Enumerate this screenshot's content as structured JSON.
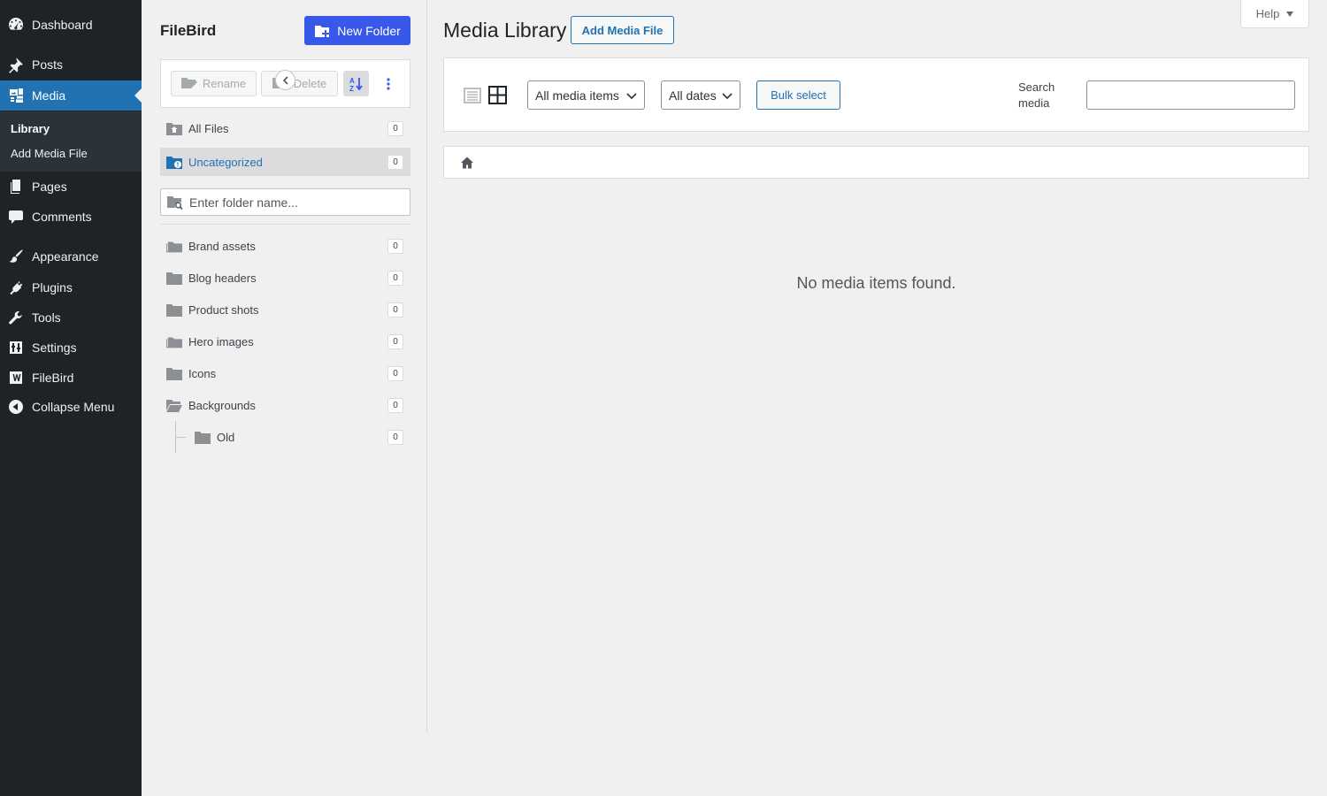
{
  "admin_menu": {
    "items": [
      {
        "key": "dashboard",
        "label": "Dashboard",
        "icon": "dashboard-icon"
      },
      {
        "key": "posts",
        "label": "Posts",
        "icon": "pushpin-icon"
      },
      {
        "key": "media",
        "label": "Media",
        "icon": "media-icon",
        "current": true
      },
      {
        "key": "pages",
        "label": "Pages",
        "icon": "pages-icon"
      },
      {
        "key": "comments",
        "label": "Comments",
        "icon": "comments-icon"
      },
      {
        "key": "appearance",
        "label": "Appearance",
        "icon": "paintbrush-icon"
      },
      {
        "key": "plugins",
        "label": "Plugins",
        "icon": "plugins-icon"
      },
      {
        "key": "tools",
        "label": "Tools",
        "icon": "wrench-icon"
      },
      {
        "key": "settings",
        "label": "Settings",
        "icon": "settings-icon"
      },
      {
        "key": "filebird",
        "label": "FileBird",
        "icon": "filebird-icon"
      },
      {
        "key": "collapse",
        "label": "Collapse Menu",
        "icon": "collapse-icon"
      }
    ],
    "submenu": {
      "library": "Library",
      "add_media_file": "Add Media File"
    }
  },
  "filebird": {
    "title": "FileBird",
    "new_folder_label": "New Folder",
    "rename_label": "Rename",
    "delete_label": "Delete",
    "all_files": {
      "label": "All Files",
      "count": "0"
    },
    "uncategorized": {
      "label": "Uncategorized",
      "count": "0"
    },
    "search_placeholder": "Enter folder name...",
    "folders": [
      {
        "label": "Brand assets",
        "count": "0",
        "icon": "folder-stack-icon"
      },
      {
        "label": "Blog headers",
        "count": "0",
        "icon": "folder-icon"
      },
      {
        "label": "Product shots",
        "count": "0",
        "icon": "folder-icon"
      },
      {
        "label": "Hero images",
        "count": "0",
        "icon": "folder-stack-icon"
      },
      {
        "label": "Icons",
        "count": "0",
        "icon": "folder-icon"
      },
      {
        "label": "Backgrounds",
        "count": "0",
        "icon": "folder-open-icon"
      },
      {
        "label": "Old",
        "count": "0",
        "icon": "folder-icon",
        "child_of": "Backgrounds"
      }
    ]
  },
  "main": {
    "title": "Media Library",
    "add_media_label": "Add Media File",
    "help_label": "Help",
    "media_type_filter": "All media items",
    "date_filter": "All dates",
    "bulk_select_label": "Bulk select",
    "search_label": "Search media",
    "search_value": "",
    "empty_message": "No media items found."
  },
  "colors": {
    "accent": "#3858e9",
    "wp_blue": "#2271b1",
    "sidebar_bg": "#1d2327"
  }
}
